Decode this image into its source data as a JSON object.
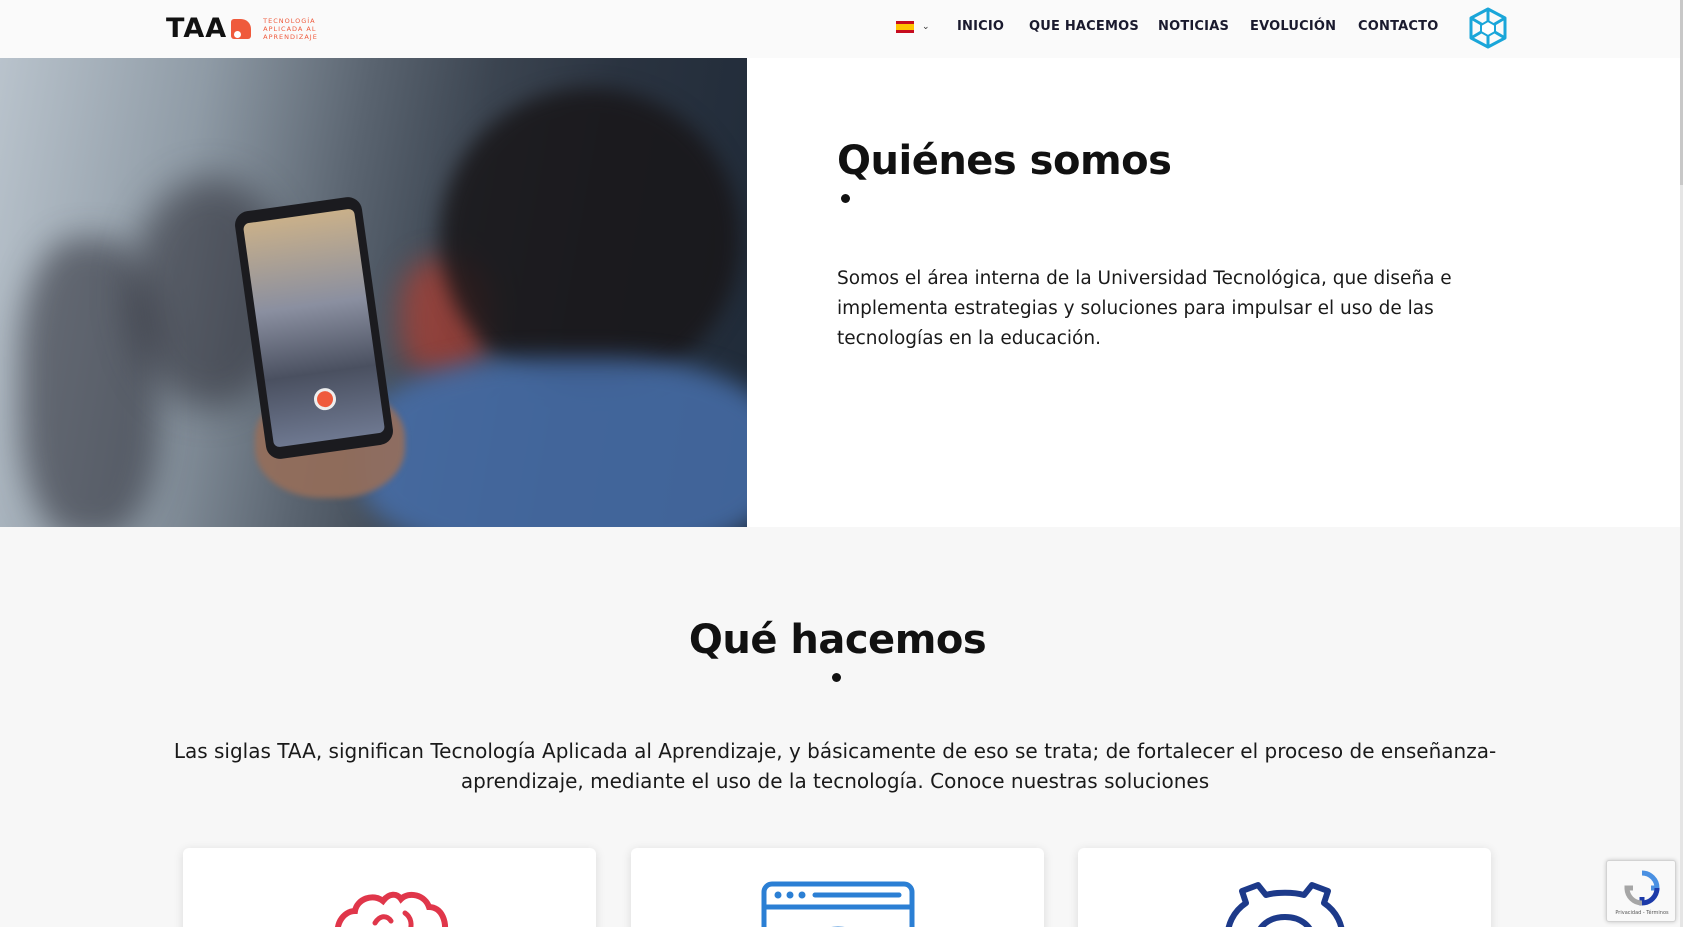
{
  "header": {
    "logo_word": "TAA",
    "logo_tagline": [
      "TECNOLOGÍA",
      "APLICADA AL",
      "APRENDIZAJE"
    ],
    "language": {
      "flag": "spain-flag-icon",
      "chevron": "⌄"
    },
    "nav": [
      "INICIO",
      "QUE HACEMOS",
      "NOTICIAS",
      "EVOLUCIÓN",
      "CONTACTO"
    ],
    "brand_icon": "hexagon-snowflake-icon"
  },
  "about": {
    "title": "Quiénes somos",
    "text": "Somos el área interna de la Universidad Tecnológica,  que diseña e implementa  estrategias y soluciones  para impulsar  el uso de las tecnologías en la educación."
  },
  "what": {
    "title": "Qué hacemos",
    "text": "Las siglas TAA, significan Tecnología Aplicada al Aprendizaje, y básicamente de eso se trata; de fortalecer el proceso de enseñanza-aprendizaje, mediante el uso de la tecnología. Conoce nuestras soluciones",
    "cards": [
      {
        "icon": "brain-icon"
      },
      {
        "icon": "browser-window-icon"
      },
      {
        "icon": "gear-icon"
      }
    ]
  },
  "recaptcha": {
    "text": "Privacidad - Términos"
  },
  "colors": {
    "accent": "#ef5a3c",
    "brand_blue": "#1aa6d9",
    "navy": "#1d3a8a",
    "red_icon": "#e0364a"
  }
}
